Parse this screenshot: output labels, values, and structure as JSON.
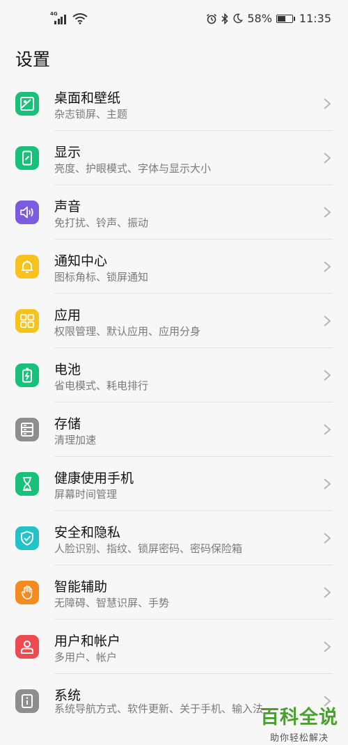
{
  "status_bar": {
    "network_type": "4G",
    "battery_percent": "58%",
    "battery_level": 0.58,
    "time": "11:35",
    "icons": [
      "signal-icon",
      "wifi-icon",
      "alarm-icon",
      "bluetooth-icon",
      "moon-icon",
      "battery-icon"
    ]
  },
  "page": {
    "title": "设置"
  },
  "items": [
    {
      "title": "桌面和壁纸",
      "subtitle": "杂志锁屏、主题",
      "icon": "wallpaper-icon",
      "color": "#19c07a"
    },
    {
      "title": "显示",
      "subtitle": "亮度、护眼模式、字体与显示大小",
      "icon": "display-icon",
      "color": "#19c07a"
    },
    {
      "title": "声音",
      "subtitle": "免打扰、铃声、振动",
      "icon": "sound-icon",
      "color": "#7b5ce0"
    },
    {
      "title": "通知中心",
      "subtitle": "图标角标、锁屏通知",
      "icon": "bell-icon",
      "color": "#f7c21b"
    },
    {
      "title": "应用",
      "subtitle": "权限管理、默认应用、应用分身",
      "icon": "apps-icon",
      "color": "#f7c21b"
    },
    {
      "title": "电池",
      "subtitle": "省电模式、耗电排行",
      "icon": "battery-icon",
      "color": "#19c07a"
    },
    {
      "title": "存储",
      "subtitle": "清理加速",
      "icon": "storage-icon",
      "color": "#8e8e8e"
    },
    {
      "title": "健康使用手机",
      "subtitle": "屏幕时间管理",
      "icon": "hourglass-icon",
      "color": "#19c07a"
    },
    {
      "title": "安全和隐私",
      "subtitle": "人脸识别、指纹、锁屏密码、密码保险箱",
      "icon": "shield-icon",
      "color": "#22c2c7"
    },
    {
      "title": "智能辅助",
      "subtitle": "无障碍、智慧识屏、手势",
      "icon": "hand-icon",
      "color": "#f58a1f"
    },
    {
      "title": "用户和帐户",
      "subtitle": "多用户、帐户",
      "icon": "user-icon",
      "color": "#ee4b50"
    },
    {
      "title": "系统",
      "subtitle": "系统导航方式、软件更新、关于手机、输入法",
      "icon": "info-icon",
      "color": "#8e8e8e"
    }
  ],
  "watermark": {
    "title": "百科全说",
    "subtitle": "助你轻松解决"
  }
}
